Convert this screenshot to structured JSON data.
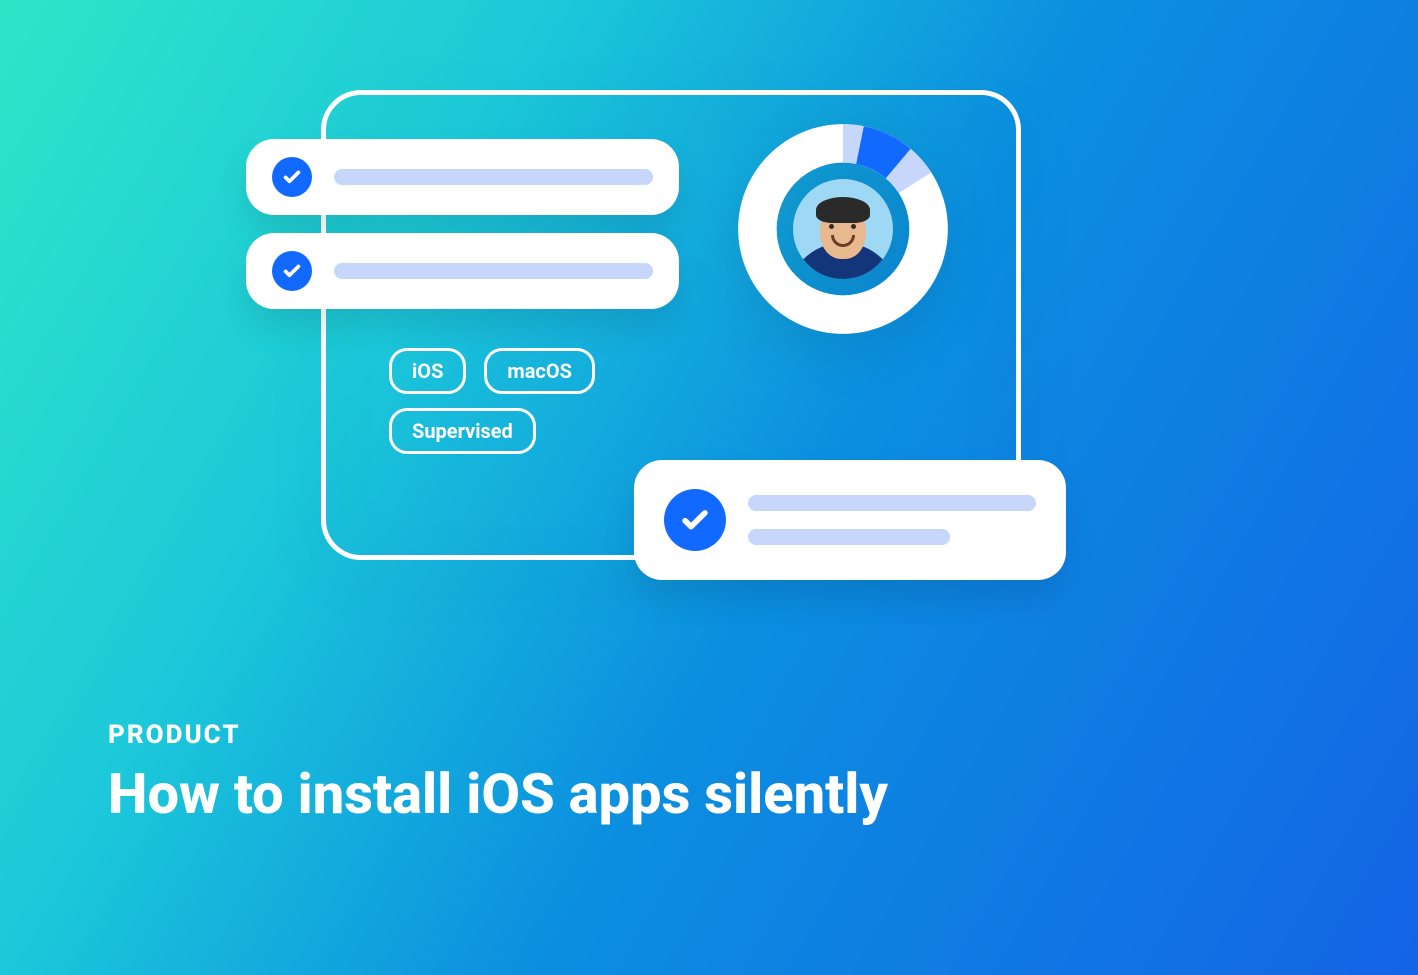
{
  "colors": {
    "accent": "#1169ff",
    "bar": "#c6d7fb",
    "white": "#ffffff",
    "gradient_from": "#2ee6c7",
    "gradient_to": "#1464e6"
  },
  "tags": [
    "iOS",
    "macOS",
    "Supervised"
  ],
  "donut": {
    "progress_percent": 8
  },
  "caption": {
    "kicker": "PRODUCT",
    "title": "How to install iOS apps silently"
  }
}
